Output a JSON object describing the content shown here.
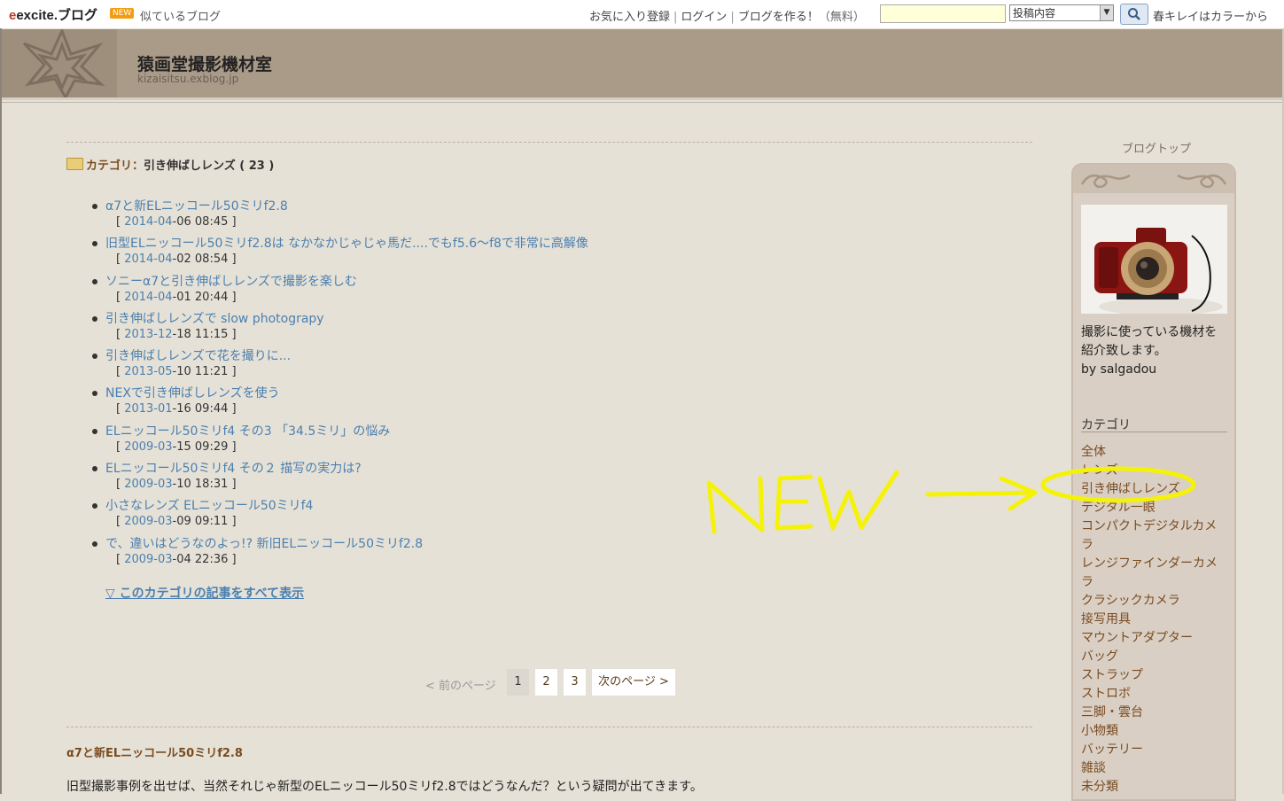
{
  "topbar": {
    "logo": "excite.ブログ",
    "new_badge": "NEW",
    "similar_blogs": "似ているブログ",
    "favorite": "お気に入り登録",
    "login": "ログイン",
    "create_blog": "ブログを作る！",
    "free": "（無料）",
    "search_value": "",
    "search_scope": "投稿内容",
    "ticker": "春キレイはカラーから"
  },
  "header": {
    "title": "猿画堂撮影機材室",
    "url": "kizaisitsu.exblog.jp"
  },
  "category": {
    "prefix": "カテゴリ：",
    "name": "引き伸ばしレンズ ( 23 )"
  },
  "posts": [
    {
      "title": "α7と新ELニッコール50ミリf2.8",
      "month": "2014-04",
      "rest": "-06 08:45"
    },
    {
      "title": "旧型ELニッコール50ミリf2.8は なかなかじゃじゃ馬だ....でもf5.6～f8で非常に高解像",
      "month": "2014-04",
      "rest": "-02 08:54"
    },
    {
      "title": "ソニーα7と引き伸ばしレンズで撮影を楽しむ",
      "month": "2014-04",
      "rest": "-01 20:44"
    },
    {
      "title": "引き伸ばしレンズで slow photograpy",
      "month": "2013-12",
      "rest": "-18 11:15"
    },
    {
      "title": "引き伸ばしレンズで花を撮りに...",
      "month": "2013-05",
      "rest": "-10 11:21"
    },
    {
      "title": "NEXで引き伸ばしレンズを使う",
      "month": "2013-01",
      "rest": "-16 09:44"
    },
    {
      "title": "ELニッコール50ミリf4 その3 「34.5ミリ」の悩み",
      "month": "2009-03",
      "rest": "-15 09:29"
    },
    {
      "title": "ELニッコール50ミリf4 その２ 描写の実力は?",
      "month": "2009-03",
      "rest": "-10 18:31"
    },
    {
      "title": "小さなレンズ ELニッコール50ミリf4",
      "month": "2009-03",
      "rest": "-09 09:11"
    },
    {
      "title": "で、違いはどうなのよっ!? 新旧ELニッコール50ミリf2.8",
      "month": "2009-03",
      "rest": "-04 22:36"
    }
  ],
  "show_all": "▽ このカテゴリの記事をすべて表示",
  "pager": {
    "prev": "< 前のページ",
    "pages": [
      "1",
      "2",
      "3"
    ],
    "current": "1",
    "next": "次のページ >"
  },
  "article": {
    "title": "α7と新ELニッコール50ミリf2.8",
    "body": "旧型撮影事例を出せば、当然それじゃ新型のELニッコール50ミリf2.8ではどうなんだ？という疑問が出てきます。"
  },
  "sidebar": {
    "blogtop": "ブログトップ",
    "profile_lines": [
      "撮影に使っている機材を",
      "紹介致します。",
      "by salgadou"
    ],
    "category_title": "カテゴリ",
    "categories": [
      "全体",
      "レンズ",
      "引き伸ばしレンズ",
      "デジタル一眼",
      "コンパクトデジタルカメラ",
      "レンジファインダーカメラ",
      "クラシックカメラ",
      "接写用具",
      "マウントアダプター",
      "バッグ",
      "ストラップ",
      "ストロボ",
      "三脚・雲台",
      "小物類",
      "バッテリー",
      "雑談",
      "未分類"
    ]
  },
  "annotation": {
    "text": "NEW",
    "color": "#f5f20a"
  }
}
